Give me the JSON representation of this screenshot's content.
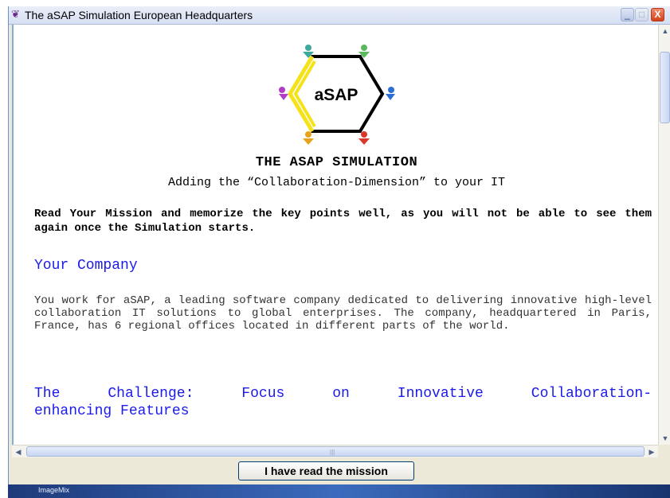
{
  "window": {
    "title": "The aSAP Simulation European Headquarters",
    "controls": {
      "minimize": "_",
      "maximize": "□",
      "close": "X"
    }
  },
  "logo": {
    "text": "aSAP"
  },
  "heading": {
    "title": "THE ASAP SIMULATION",
    "subtitle": "Adding the “Collaboration-Dimension” to your IT"
  },
  "intro": "Read Your Mission and memorize the key points well, as you will not be able to see them again once the Simulation starts.",
  "sections": [
    {
      "heading": "Your Company",
      "body": "You work for aSAP, a leading software company dedicated to delivering innovative high-level collaboration IT solutions to global enterprises. The company, headquartered in Paris, France, has 6 regional offices located in different parts of the world."
    },
    {
      "heading_line1": "The Challenge: Focus on Innovative Collaboration-",
      "heading_line2": "enhancing Features"
    }
  ],
  "footer": {
    "button_label": "I have read the mission"
  },
  "taskbar": {
    "label": "ImageMix"
  },
  "colors": {
    "section_heading": "#1a1aee",
    "accent_yellow": "#f5e21b"
  }
}
